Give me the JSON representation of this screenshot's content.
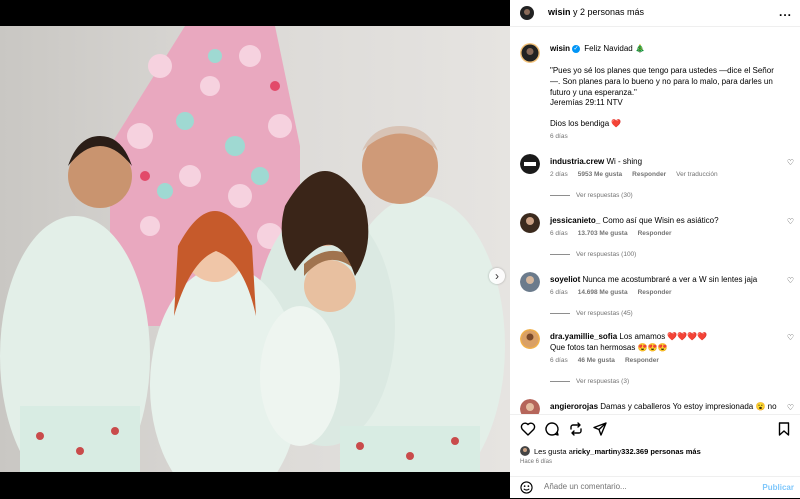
{
  "header": {
    "username": "wisin",
    "others": " y 2 personas más",
    "more_label": "..."
  },
  "caption": {
    "username": "wisin",
    "verified": "✓",
    "text": "Feliz Navidad 🎄",
    "quote": "\"Pues yo sé los planes que tengo para ustedes —dice el Señor—. Son planes para lo bueno y no para lo malo, para darles un futuro y una esperanza.\"",
    "verse": "Jeremías 29:11 NTV",
    "blessing": "Dios los bendiga ❤️",
    "time": "6 días"
  },
  "comments": [
    {
      "username": "industria.crew",
      "text": "Wi - shing",
      "time": "2 días",
      "likes": "5953 Me gusta",
      "reply": "Responder",
      "translate": "Ver traducción",
      "replies": "Ver respuestas (30)",
      "avatar_color": "#1a1a1a"
    },
    {
      "username": "jessicanieto_",
      "text": "Como así que Wisin es asiático?",
      "time": "6 días",
      "likes": "13.703 Me gusta",
      "reply": "Responder",
      "replies": "Ver respuestas (100)",
      "avatar_color": "#3b2a1e"
    },
    {
      "username": "soyeliot",
      "text": "Nunca me acostumbraré a ver a W sin lentes jaja",
      "time": "6 días",
      "likes": "14.698 Me gusta",
      "reply": "Responder",
      "replies": "Ver respuestas (45)",
      "avatar_color": "#6b7b8c"
    },
    {
      "username": "dra.yamillie_sofia",
      "text": "Los amamos ❤️❤️❤️❤️",
      "text2": "Que fotos tan hermosas 😍😍😍",
      "time": "6 días",
      "likes": "46 Me gusta",
      "reply": "Responder",
      "replies": "Ver respuestas (3)",
      "avatar_color": "#d9a066"
    },
    {
      "username": "angierorojas",
      "text": "Damas y caballeros Yo estoy impresionada 😮 no",
      "avatar_color": "#b5655a"
    }
  ],
  "likes": {
    "prefix": "Les gusta a ",
    "user": "ricky_martin",
    "middle": " y ",
    "count": "332.369 personas más",
    "time": "Hace 6 días"
  },
  "add_comment": {
    "placeholder": "Añade un comentario...",
    "post_label": "Publicar"
  },
  "colors": {
    "accent_blue": "#0095f6",
    "post_disabled": "#7fc7fb",
    "meta_gray": "#737373"
  }
}
